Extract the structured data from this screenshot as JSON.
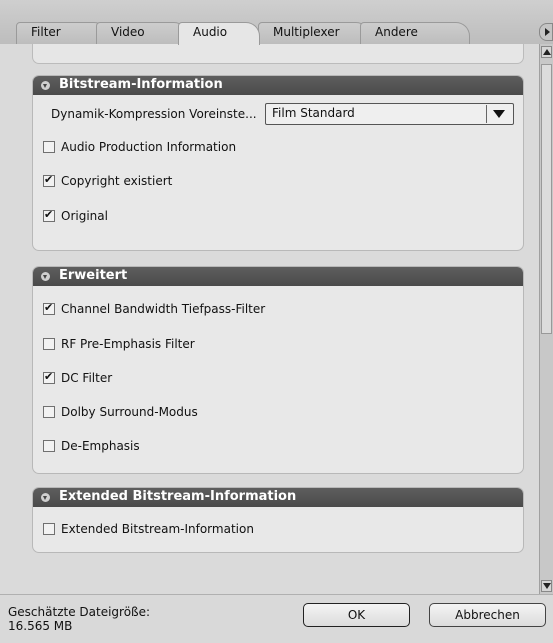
{
  "tabs": [
    {
      "label": "Filter",
      "active": false
    },
    {
      "label": "Video",
      "active": false
    },
    {
      "label": "Audio",
      "active": true
    },
    {
      "label": "Multiplexer",
      "active": false
    },
    {
      "label": "Andere",
      "active": false
    }
  ],
  "sections": {
    "bitstream": {
      "title": "Bitstream-Information",
      "dynamic_label": "Dynamik-Kompression Voreinste...",
      "dynamic_value": "Film Standard",
      "items": [
        {
          "label": "Audio Production Information",
          "checked": false
        },
        {
          "label": "Copyright existiert",
          "checked": true
        },
        {
          "label": "Original",
          "checked": true
        }
      ]
    },
    "erweitert": {
      "title": "Erweitert",
      "items": [
        {
          "label": "Channel Bandwidth Tiefpass-Filter",
          "checked": true
        },
        {
          "label": "RF Pre-Emphasis Filter",
          "checked": false
        },
        {
          "label": "DC Filter",
          "checked": true
        },
        {
          "label": "Dolby Surround-Modus",
          "checked": false
        },
        {
          "label": "De-Emphasis",
          "checked": false
        }
      ]
    },
    "extended": {
      "title": "Extended Bitstream-Information",
      "items": [
        {
          "label": "Extended Bitstream-Information",
          "checked": false
        }
      ]
    }
  },
  "footer": {
    "size_label": "Geschätzte Dateigröße:",
    "size_value": "16.565 MB",
    "ok_label": "OK",
    "cancel_label": "Abbrechen"
  }
}
